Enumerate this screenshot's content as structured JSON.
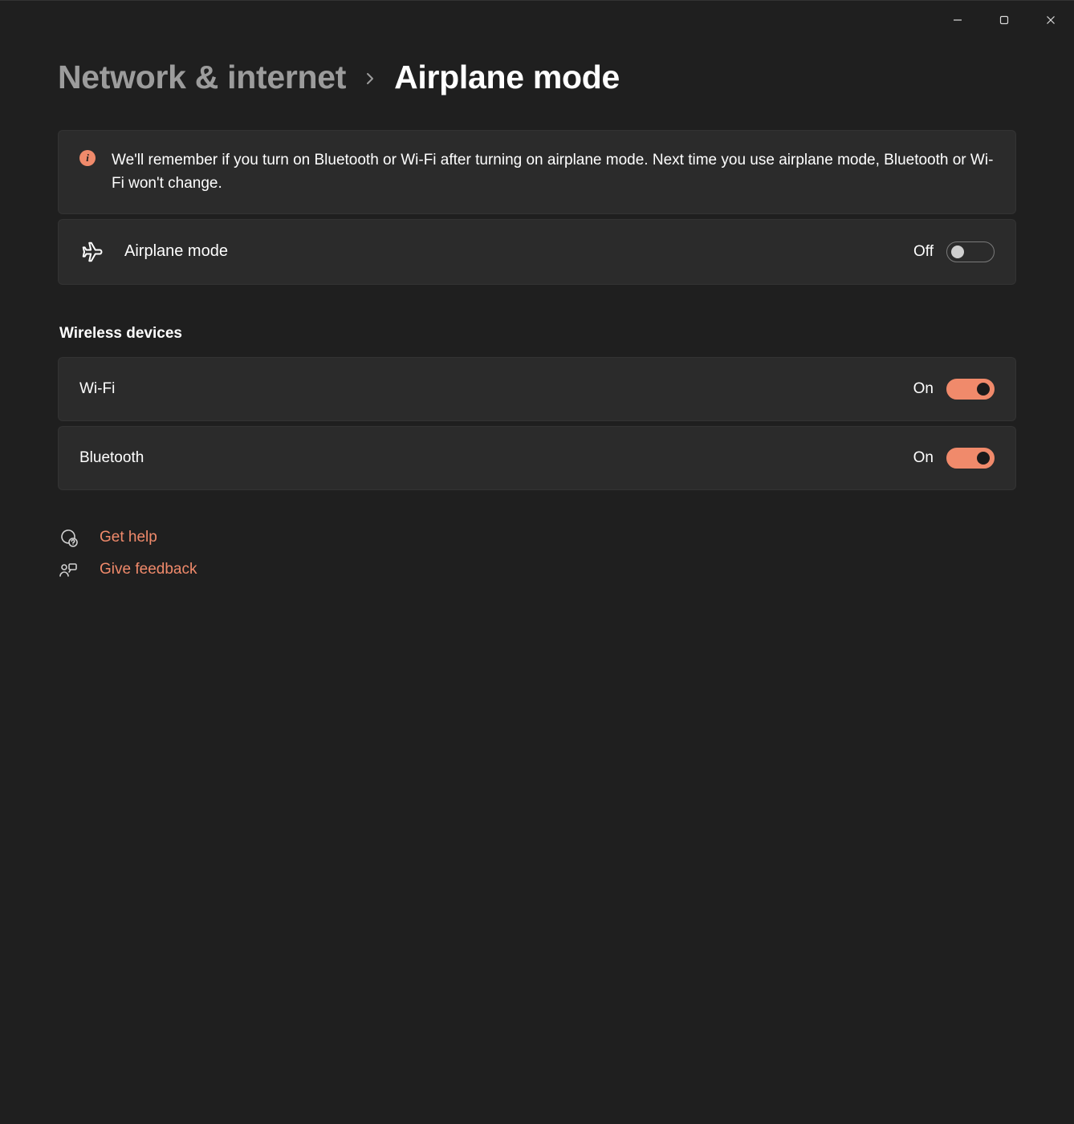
{
  "breadcrumb": {
    "parent": "Network & internet",
    "current": "Airplane mode"
  },
  "info_banner": {
    "text": "We'll remember if you turn on Bluetooth or Wi-Fi after turning on airplane mode. Next time you use airplane mode, Bluetooth or Wi-Fi won't change."
  },
  "airplane": {
    "label": "Airplane mode",
    "state_text": "Off",
    "on": false
  },
  "wireless_section_title": "Wireless devices",
  "wifi": {
    "label": "Wi-Fi",
    "state_text": "On",
    "on": true
  },
  "bluetooth": {
    "label": "Bluetooth",
    "state_text": "On",
    "on": true
  },
  "links": {
    "help": "Get help",
    "feedback": "Give feedback"
  },
  "state_labels": {
    "on": "On",
    "off": "Off"
  }
}
